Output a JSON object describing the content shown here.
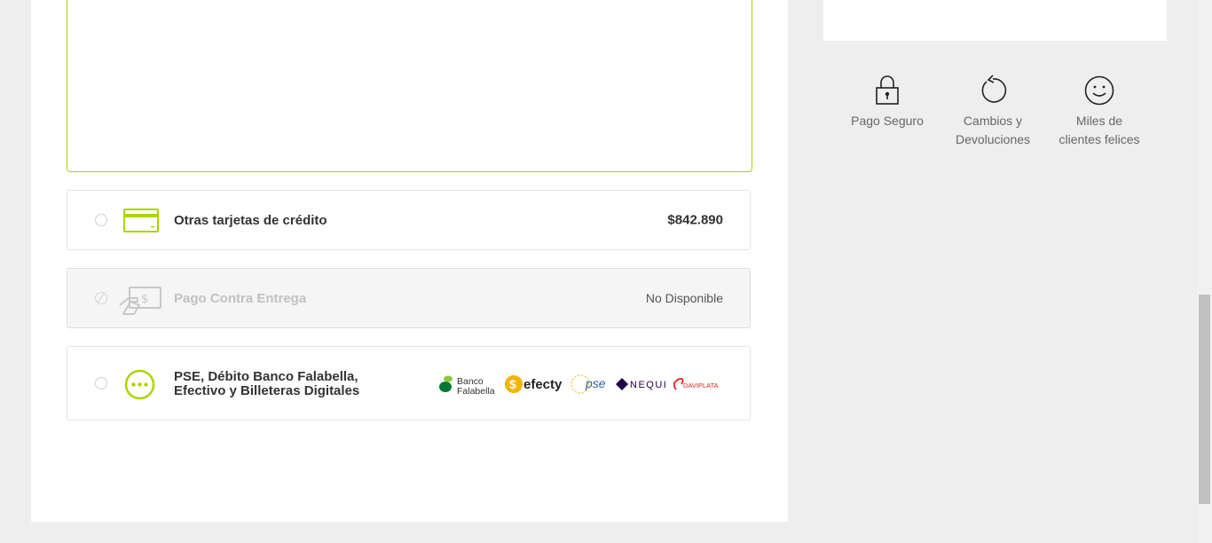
{
  "payment_options": [
    {
      "title": "Otras tarjetas de crédito",
      "right": "$842.890",
      "icon": "credit-card-icon"
    },
    {
      "title": "Pago Contra Entrega",
      "right": "No Disponible",
      "icon": "cash-on-delivery-icon"
    },
    {
      "title_line1": "PSE, Débito Banco Falabella,",
      "title_line2": "Efectivo y Billeteras Digitales",
      "icon": "more-options-icon",
      "logos": [
        "Banco",
        "Falabella",
        "efecty",
        "pse",
        "NEQUI",
        "DAVIPLATA"
      ]
    }
  ],
  "features": [
    {
      "label": "Pago Seguro",
      "icon": "padlock-icon"
    },
    {
      "label_line1": "Cambios y",
      "label_line2": "Devoluciones",
      "icon": "return-arrow-icon"
    },
    {
      "label_line1": "Miles de",
      "label_line2": "clientes felices",
      "icon": "smiley-icon"
    }
  ],
  "colors": {
    "accent": "#aad500",
    "disabled": "#c8c8c8",
    "pse_blue": "#2a5fa8"
  }
}
